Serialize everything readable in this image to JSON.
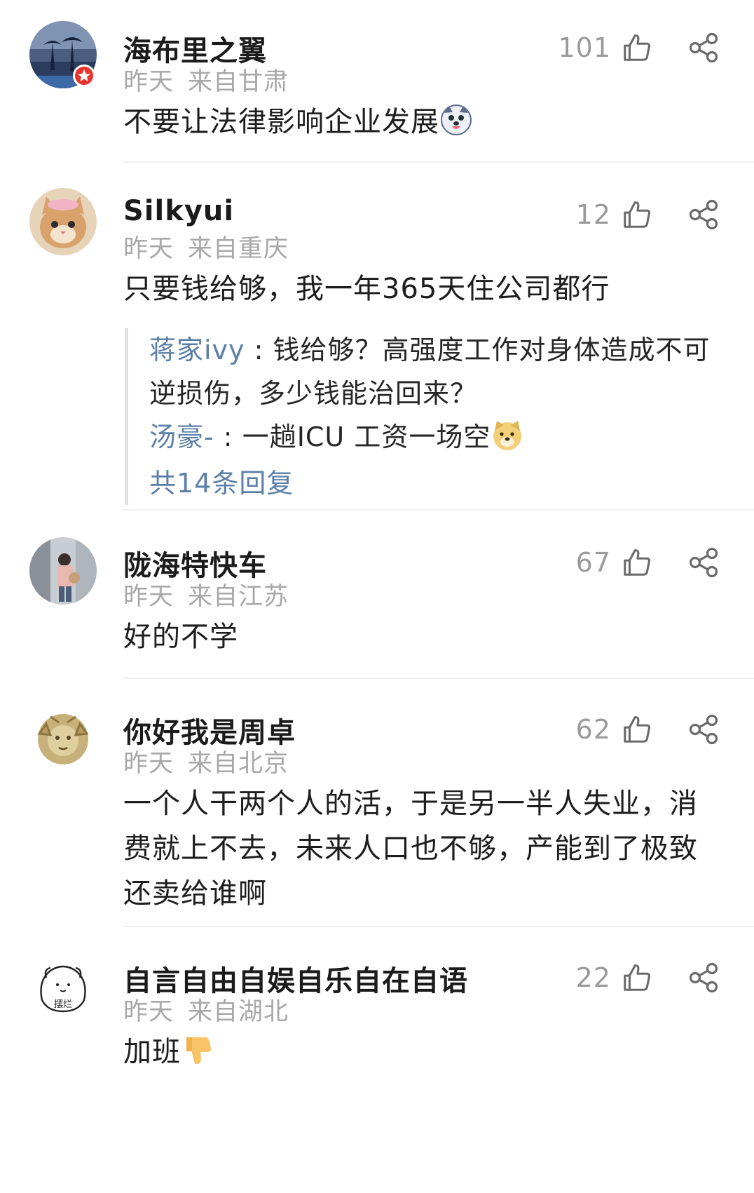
{
  "comments": [
    {
      "username": "海布里之翼",
      "time": "昨天",
      "location": "来自甘肃",
      "likes": "101",
      "text": "不要让法律影响企业发展",
      "emoji": "dog-face-emoji",
      "verified": true
    },
    {
      "username": "Silkyui",
      "time": "昨天",
      "location": "来自重庆",
      "likes": "12",
      "text": "只要钱给够，我一年365天住公司都行",
      "replies": [
        {
          "user": "蒋家ivy",
          "text": "钱给够？高强度工作对身体造成不可逆损伤，多少钱能治回来？"
        },
        {
          "user": "汤豪-",
          "text": "一趟ICU 工资一场空",
          "emoji": "doge-emoji"
        }
      ],
      "more_replies": "共14条回复"
    },
    {
      "username": "陇海特快车",
      "time": "昨天",
      "location": "来自江苏",
      "likes": "67",
      "text": "好的不学"
    },
    {
      "username": "你好我是周卓",
      "time": "昨天",
      "location": "来自北京",
      "likes": "62",
      "text": "一个人干两个人的活，于是另一半人失业，消费就上不去，未来人口也不够，产能到了极致还卖给谁啊"
    },
    {
      "username": "自言自由自娱自乐自在自语",
      "time": "昨天",
      "location": "来自湖北",
      "likes": "22",
      "text": "加班",
      "emoji": "thumbs-down-emoji",
      "avatar_text": "摆烂"
    }
  ],
  "icons": {
    "like": "thumb-up-outline-icon",
    "share": "share-icon"
  }
}
